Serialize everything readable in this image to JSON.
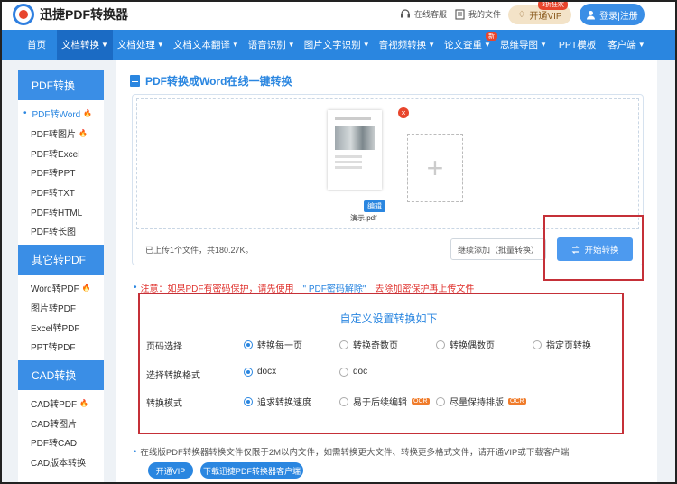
{
  "header": {
    "logo_text": "迅捷PDF转换器",
    "service_label": "在线客服",
    "myfiles_label": "我的文件",
    "vip_label": "开通VIP",
    "vip_tag": "3折狂欢",
    "login_label": "登录|注册"
  },
  "nav": {
    "items": [
      {
        "label": "首页"
      },
      {
        "label": "文档转换"
      },
      {
        "label": "文档处理"
      },
      {
        "label": "文档文本翻译"
      },
      {
        "label": "语音识别"
      },
      {
        "label": "图片文字识别"
      },
      {
        "label": "音视频转换"
      },
      {
        "label": "论文查重",
        "badge": "新"
      },
      {
        "label": "思维导图"
      },
      {
        "label": "PPT模板"
      },
      {
        "label": "客户端"
      }
    ]
  },
  "sidebar": {
    "groups": [
      {
        "title": "PDF转换",
        "items": [
          "PDF转Word",
          "PDF转图片",
          "PDF转Excel",
          "PDF转PPT",
          "PDF转TXT",
          "PDF转HTML",
          "PDF转长图"
        ]
      },
      {
        "title": "其它转PDF",
        "items": [
          "Word转PDF",
          "图片转PDF",
          "Excel转PDF",
          "PPT转PDF"
        ]
      },
      {
        "title": "CAD转换",
        "items": [
          "CAD转PDF",
          "CAD转图片",
          "PDF转CAD",
          "CAD版本转换"
        ]
      }
    ]
  },
  "main": {
    "title": "PDF转换成Word在线一键转换",
    "edit_label": "编辑",
    "file_name": "演示.pdf",
    "delete_label": "×",
    "add_plus": "+",
    "upload_info": "已上传1个文件，共180.27K。",
    "continue_label": "继续添加（批量转换）",
    "start_label": "开始转换",
    "notice_prefix": "注意：如果PDF有密码保护，请先使用",
    "notice_link": "\" PDF密码解除\"",
    "notice_suffix": "去除加密保护再上传文件",
    "settings_title": "自定义设置转换如下",
    "rows": [
      {
        "label": "页码选择",
        "options": [
          "转换每一页",
          "转换奇数页",
          "转换偶数页",
          "指定页转换"
        ]
      },
      {
        "label": "选择转换格式",
        "options": [
          "docx",
          "doc"
        ]
      },
      {
        "label": "转换模式",
        "options": [
          "追求转换速度",
          "易于后续编辑",
          "尽量保持排版"
        ],
        "ocr": "OCR"
      }
    ],
    "bottom_note": "在线版PDF转换器转换文件仅限于2M以内文件，如需转换更大文件、转换更多格式文件，请开通VIP或下载客户端",
    "vip_btn": "开通VIP",
    "download_btn": "下载迅捷PDF转换器客户端"
  }
}
